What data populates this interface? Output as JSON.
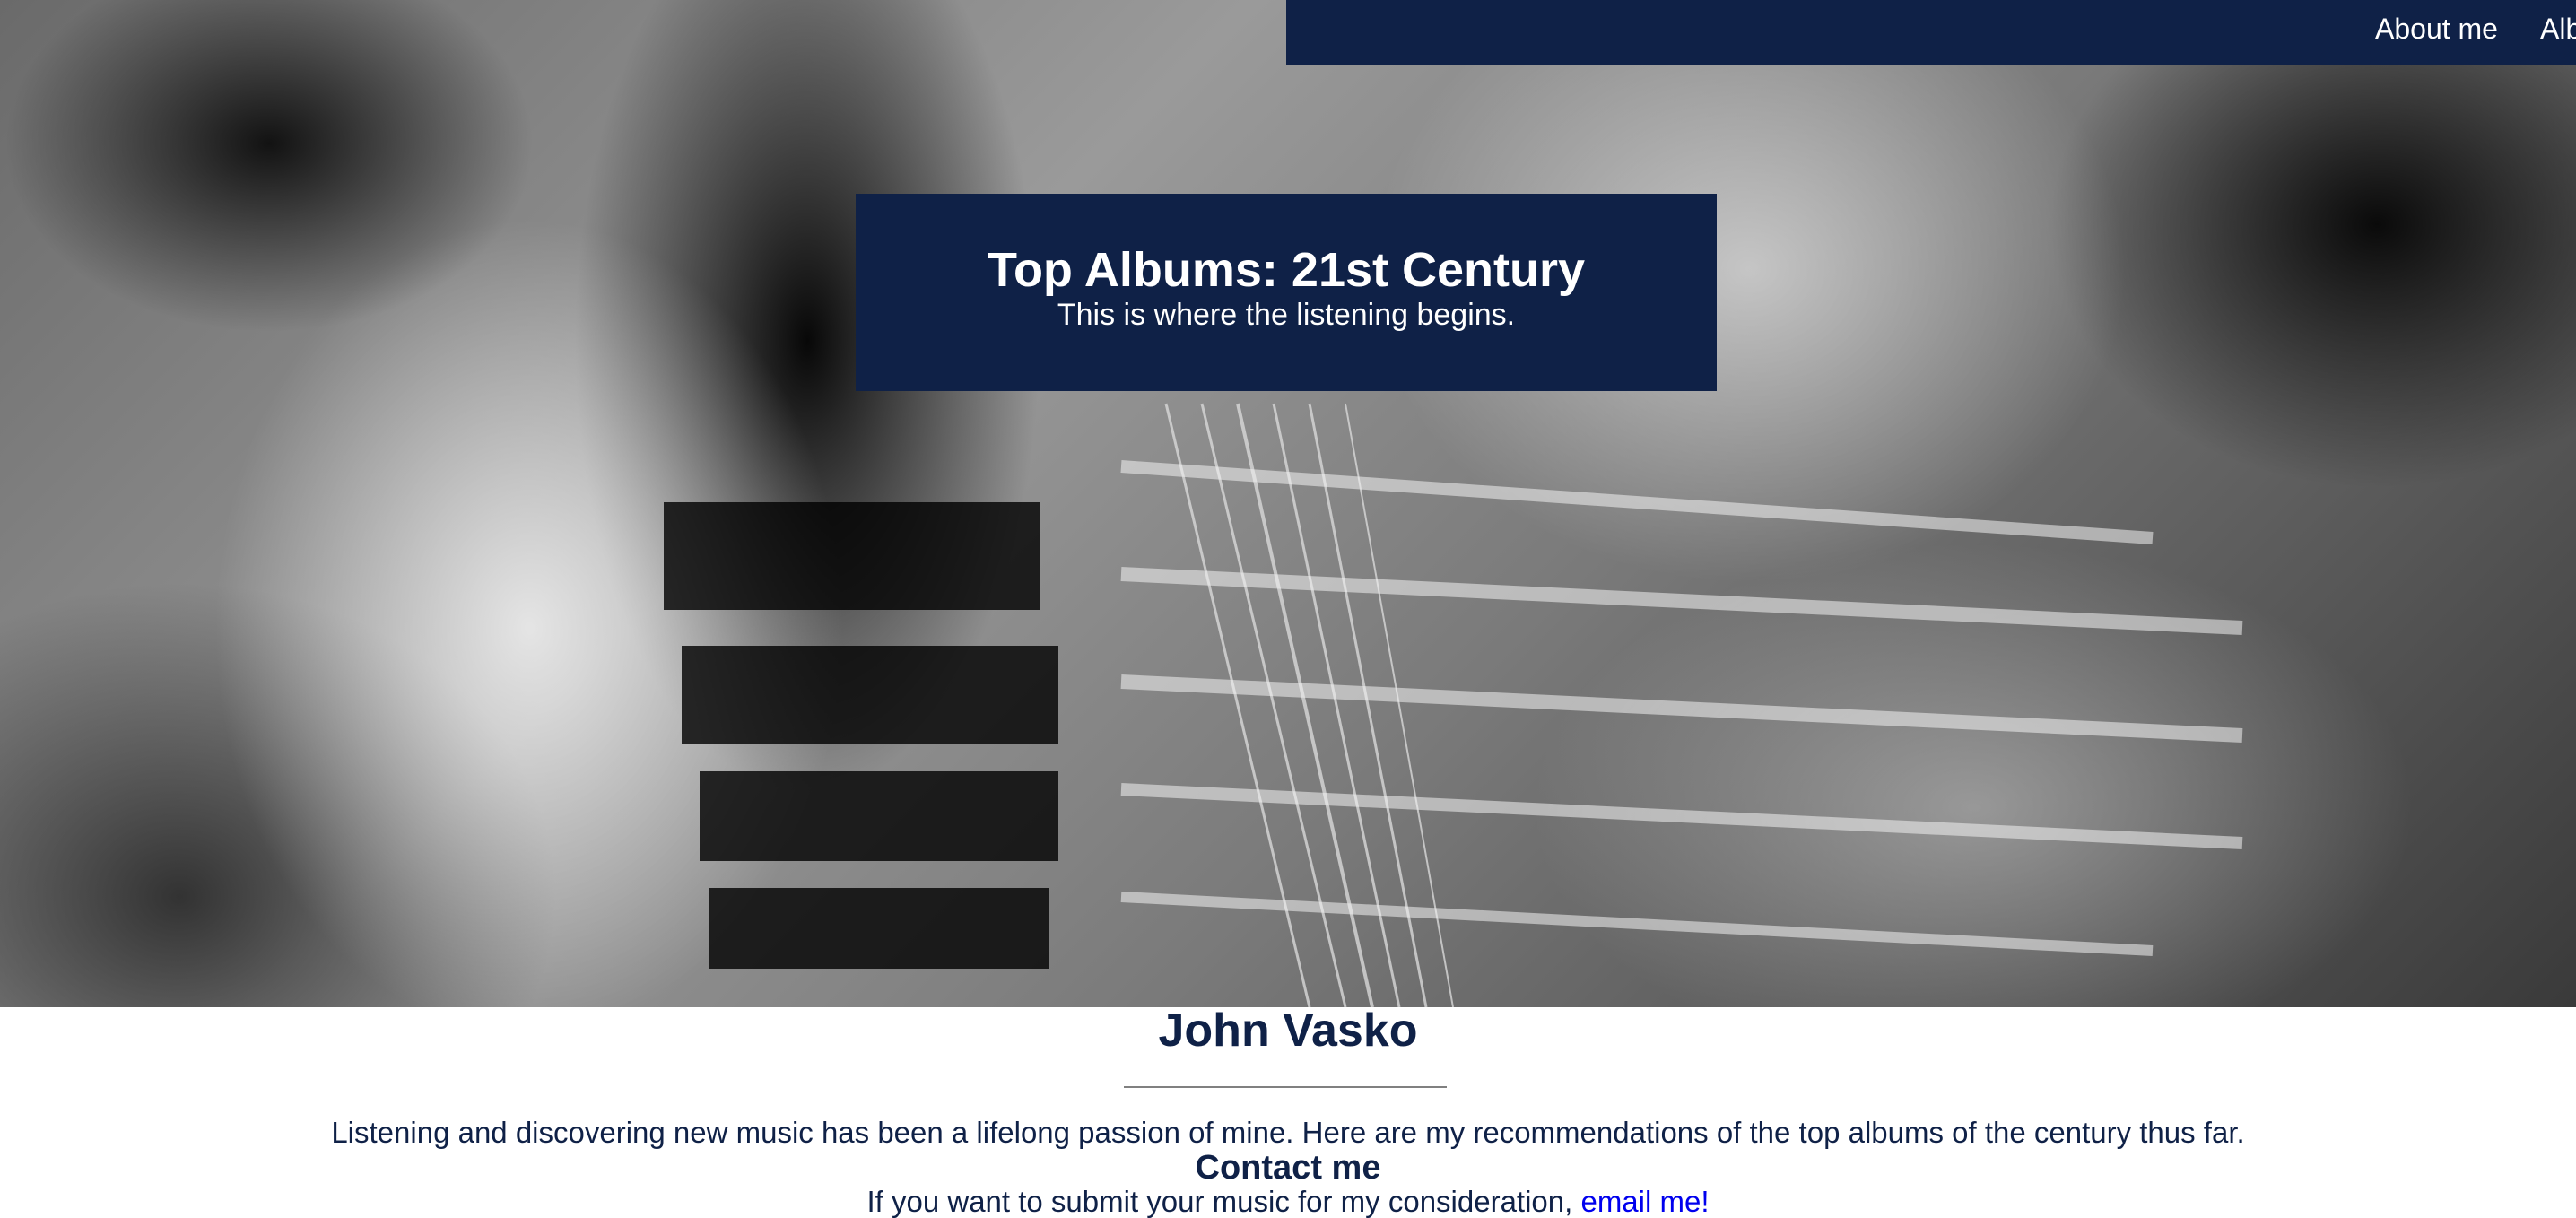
{
  "nav": {
    "items": [
      {
        "label": "About me"
      },
      {
        "label": "Albums"
      }
    ]
  },
  "hero": {
    "title": "Top Albums: 21st Century",
    "subtitle": "This is where the listening begins."
  },
  "about": {
    "name": "John Vasko",
    "intro": "Listening and discovering new music has been a lifelong passion of mine. Here are my recommendations of the top albums of the century thus far."
  },
  "contact": {
    "heading": "Contact me",
    "text": "If you want to submit your music for my consideration, ",
    "link_label": "email me!"
  },
  "colors": {
    "navy": "#0f2147",
    "link": "#0000ee",
    "divider": "#808080"
  }
}
